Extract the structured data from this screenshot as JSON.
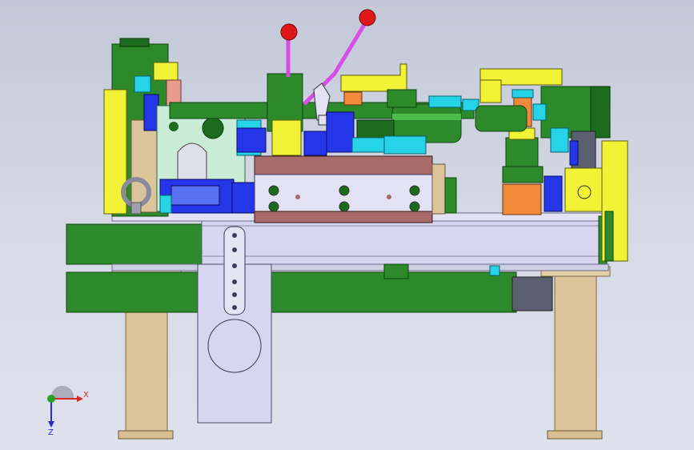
{
  "viewport": {
    "background_top": "#c3c8d8",
    "background_bottom": "#dfe2ec"
  },
  "model": {
    "type": "cad-assembly-fixture",
    "colors": {
      "base_green": "#2c8a2a",
      "plate_lilac": "#d6d6f0",
      "leg_tan": "#dcc49a",
      "block_brown": "#a86a6a",
      "cyan": "#27d3e6",
      "blue": "#2536e8",
      "yellow": "#f2f236",
      "orange": "#f08a3a",
      "pink": "#d84de6",
      "dark_green": "#1d6b1d",
      "red_knob": "#e0161b",
      "salmon": "#e89a8c"
    }
  },
  "triad": {
    "x_label": "X",
    "z_label": "Z",
    "x_color": "#d42a2a",
    "z_color": "#2a2ad4",
    "y_color": "#2aa02a"
  }
}
